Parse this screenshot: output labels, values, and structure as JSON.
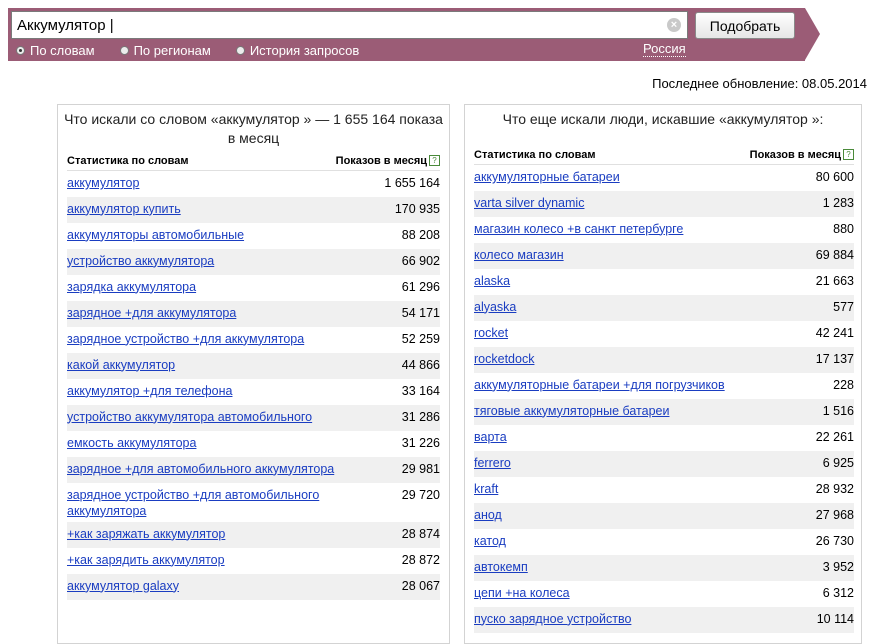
{
  "search": {
    "query": "Аккумулятор |",
    "submit_label": "Подобрать",
    "modes": [
      {
        "label": "По словам",
        "checked": true
      },
      {
        "label": "По регионам",
        "checked": false
      },
      {
        "label": "История запросов",
        "checked": false
      }
    ],
    "region": "Россия"
  },
  "last_update": "Последнее обновление: 08.05.2014",
  "left": {
    "title": "Что искали со словом «аккумулятор » — 1 655 164 показа в месяц",
    "col_keyword": "Статистика по словам",
    "col_count": "Показов в месяц",
    "rows": [
      {
        "kw": "аккумулятор",
        "n": "1 655 164"
      },
      {
        "kw": "аккумулятор купить",
        "n": "170 935"
      },
      {
        "kw": "аккумуляторы автомобильные",
        "n": "88 208"
      },
      {
        "kw": "устройство аккумулятора",
        "n": "66 902"
      },
      {
        "kw": "зарядка аккумулятора",
        "n": "61 296"
      },
      {
        "kw": "зарядное +для аккумулятора",
        "n": "54 171"
      },
      {
        "kw": "зарядное устройство +для аккумулятора",
        "n": "52 259"
      },
      {
        "kw": "какой аккумулятор",
        "n": "44 866"
      },
      {
        "kw": "аккумулятор +для телефона",
        "n": "33 164"
      },
      {
        "kw": "устройство аккумулятора автомобильного",
        "n": "31 286"
      },
      {
        "kw": "емкость аккумулятора",
        "n": "31 226"
      },
      {
        "kw": "зарядное +для автомобильного аккумулятора",
        "n": "29 981"
      },
      {
        "kw": "зарядное устройство +для автомобильного аккумулятора",
        "n": "29 720"
      },
      {
        "kw": "+как заряжать аккумулятор",
        "n": "28 874"
      },
      {
        "kw": "+как зарядить аккумулятор",
        "n": "28 872"
      },
      {
        "kw": "аккумулятор galaxy",
        "n": "28 067"
      }
    ]
  },
  "right": {
    "title": "Что еще искали люди, искавшие «аккумулятор »:",
    "col_keyword": "Статистика по словам",
    "col_count": "Показов в месяц",
    "rows": [
      {
        "kw": "аккумуляторные батареи",
        "n": "80 600"
      },
      {
        "kw": "varta silver dynamic",
        "n": "1 283"
      },
      {
        "kw": "магазин колесо +в санкт петербурге",
        "n": "880"
      },
      {
        "kw": "колесо магазин",
        "n": "69 884"
      },
      {
        "kw": "alaska",
        "n": "21 663"
      },
      {
        "kw": "alyaska",
        "n": "577"
      },
      {
        "kw": "rocket",
        "n": "42 241"
      },
      {
        "kw": "rocketdock",
        "n": "17 137"
      },
      {
        "kw": "аккумуляторные батареи +для погрузчиков",
        "n": "228"
      },
      {
        "kw": "тяговые аккумуляторные батареи",
        "n": "1 516"
      },
      {
        "kw": "варта",
        "n": "22 261"
      },
      {
        "kw": "ferrero",
        "n": "6 925"
      },
      {
        "kw": "kraft",
        "n": "28 932"
      },
      {
        "kw": "анод",
        "n": "27 968"
      },
      {
        "kw": "катод",
        "n": "26 730"
      },
      {
        "kw": "автокемп",
        "n": "3 952"
      },
      {
        "kw": "цепи +на колеса",
        "n": "6 312"
      },
      {
        "kw": "пуско зарядное устройство",
        "n": "10 114"
      }
    ]
  }
}
